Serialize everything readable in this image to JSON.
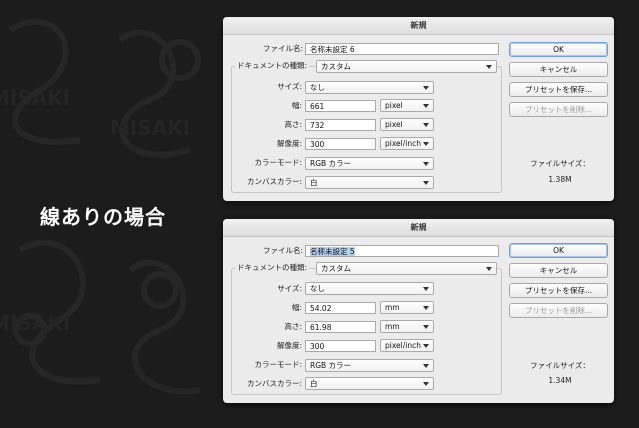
{
  "caption": "線ありの場合",
  "bg_watermark": "MISAKI",
  "dialogs": [
    {
      "title": "新規",
      "file_name_label": "ファイル名:",
      "file_name_value": "名称未設定 6",
      "doc_type_label": "ドキュメントの種類:",
      "doc_type_value": "カスタム",
      "size_label": "サイズ:",
      "size_value": "なし",
      "width_label": "幅:",
      "width_value": "661",
      "width_unit": "pixel",
      "height_label": "高さ:",
      "height_value": "732",
      "height_unit": "pixel",
      "resolution_label": "解像度:",
      "resolution_value": "300",
      "resolution_unit": "pixel/inch",
      "color_mode_label": "カラーモード:",
      "color_mode_value": "RGB カラー",
      "canvas_color_label": "カンバスカラー:",
      "canvas_color_value": "白",
      "ok_label": "OK",
      "cancel_label": "キャンセル",
      "save_preset_label": "プリセットを保存...",
      "delete_preset_label": "プリセットを削除...",
      "file_size_label": "ファイルサイズ：",
      "file_size_value": "1.38M",
      "filename_selected": false
    },
    {
      "title": "新規",
      "file_name_label": "ファイル名:",
      "file_name_value": "名称未設定 5",
      "doc_type_label": "ドキュメントの種類:",
      "doc_type_value": "カスタム",
      "size_label": "サイズ:",
      "size_value": "なし",
      "width_label": "幅:",
      "width_value": "54.02",
      "width_unit": "mm",
      "height_label": "高さ:",
      "height_value": "61.98",
      "height_unit": "mm",
      "resolution_label": "解像度:",
      "resolution_value": "300",
      "resolution_unit": "pixel/inch",
      "color_mode_label": "カラーモード:",
      "color_mode_value": "RGB カラー",
      "canvas_color_label": "カンバスカラー:",
      "canvas_color_value": "白",
      "ok_label": "OK",
      "cancel_label": "キャンセル",
      "save_preset_label": "プリセットを保存...",
      "delete_preset_label": "プリセットを削除...",
      "file_size_label": "ファイルサイズ：",
      "file_size_value": "1.34M",
      "filename_selected": true
    }
  ],
  "colors": {
    "background": "#1c1c1c",
    "dialog": "#ececec",
    "default_button_border": "#6d9ee3",
    "selection": "#b3d1f5"
  }
}
